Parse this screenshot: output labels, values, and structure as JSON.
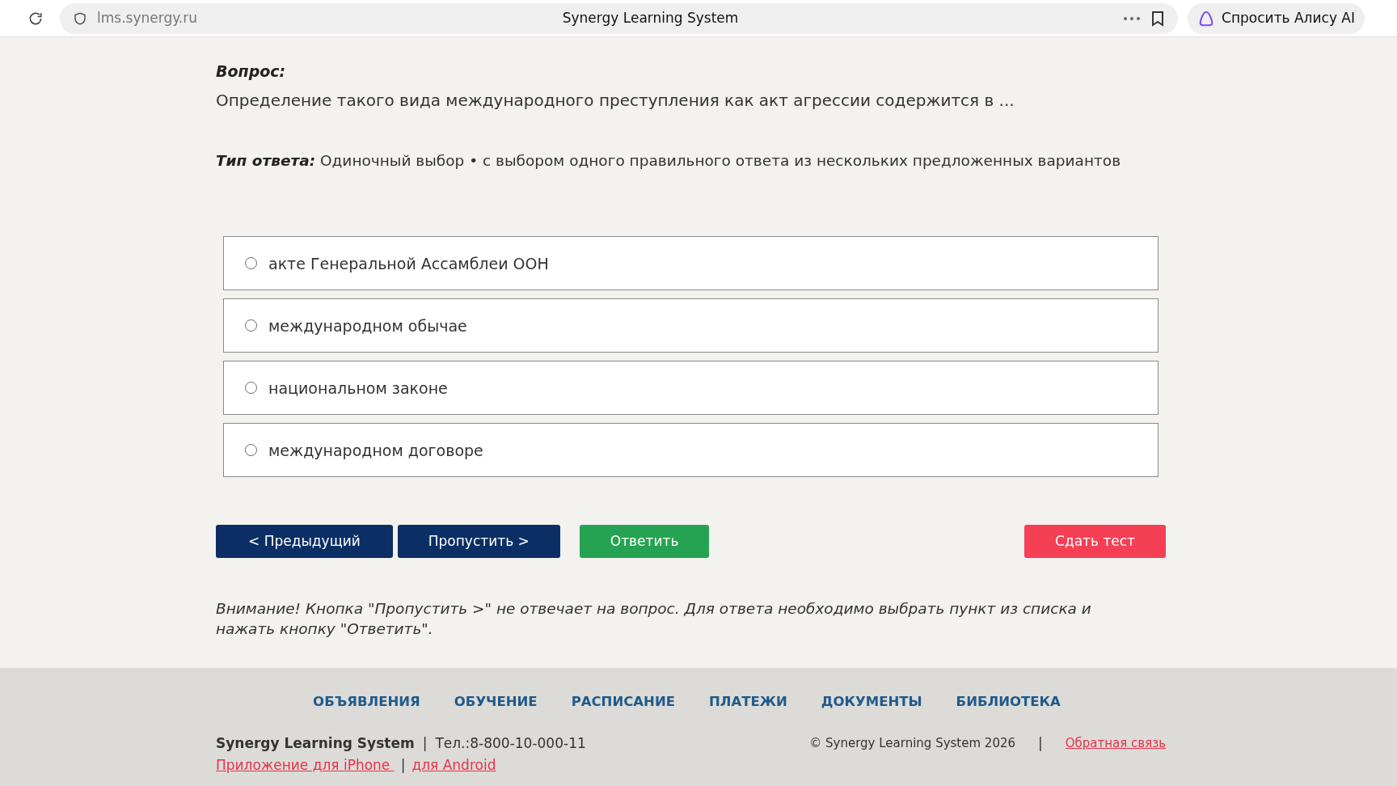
{
  "browser": {
    "url": "lms.synergy.ru",
    "title": "Synergy Learning System",
    "assistant": "Спросить Алису AI"
  },
  "question": {
    "label": "Вопрос:",
    "text": "Определение такого вида международного преступления как акт агрессии содержится в ..."
  },
  "answer_type": {
    "label": "Тип ответа:",
    "text": "Одиночный выбор • с выбором одного правильного ответа из нескольких предложенных вариантов"
  },
  "options": [
    {
      "label": "акте Генеральной Ассамблеи ООН",
      "selected": false
    },
    {
      "label": "международном обычае",
      "selected": false
    },
    {
      "label": "национальном законе",
      "selected": false
    },
    {
      "label": "международном договоре",
      "selected": false
    }
  ],
  "buttons": [
    {
      "label": "< Предыдущий",
      "kind": "nav"
    },
    {
      "label": "Пропустить >",
      "kind": "nav"
    },
    {
      "label": "Ответить",
      "kind": "answer"
    },
    {
      "label": "Сдать тест",
      "kind": "finish"
    }
  ],
  "notice": "Внимание! Кнопка \"Пропустить >\" не отвечает на вопрос. Для ответа необходимо выбрать пункт из списка и нажать кнопку \"Ответить\".",
  "footer": {
    "nav": [
      "ОБЪЯВЛЕНИЯ",
      "ОБУЧЕНИЕ",
      "РАСПИСАНИЕ",
      "ПЛАТЕЖИ",
      "ДОКУМЕНТЫ",
      "БИБЛИОТЕКА"
    ],
    "brand": "Synergy Learning System",
    "separator": "|",
    "phone": "Тел.:8-800-10-000-11",
    "copyright": "© Synergy Learning System 2026",
    "feedback": "Обратная связь",
    "iphone": "Приложение для iPhone ",
    "android": "для Android"
  }
}
